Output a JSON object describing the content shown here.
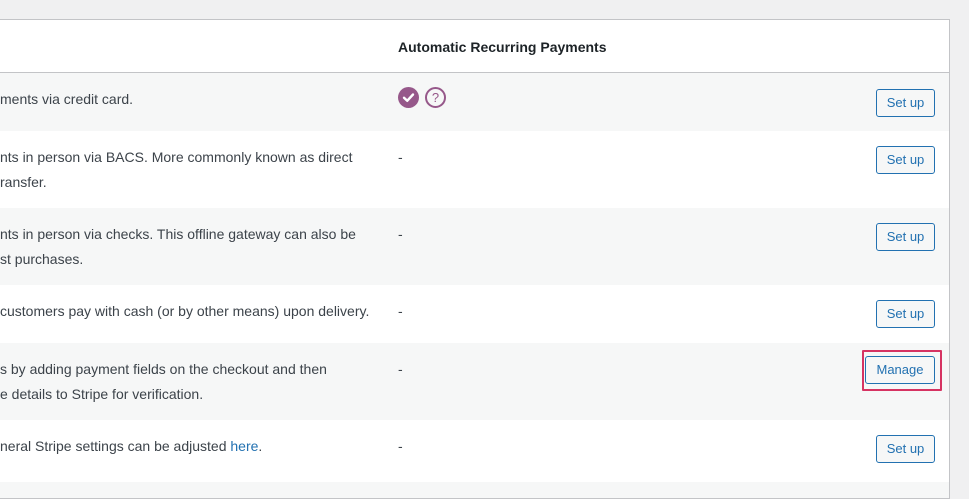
{
  "table": {
    "headers": {
      "description": "",
      "automatic_recurring_payments": "Automatic Recurring Payments"
    },
    "rows": [
      {
        "desc_lines": [
          "ments via credit card."
        ],
        "recurring": "",
        "recurring_icons": [
          "check-circle-icon",
          "help-circle-icon"
        ],
        "action": "Set up"
      },
      {
        "desc_lines": [
          "nts in person via BACS. More commonly known as direct",
          "ransfer."
        ],
        "recurring": "-",
        "action": "Set up"
      },
      {
        "desc_lines": [
          "nts in person via checks. This offline gateway can also be",
          "st purchases."
        ],
        "recurring": "-",
        "action": "Set up"
      },
      {
        "desc_lines": [
          "customers pay with cash (or by other means) upon delivery."
        ],
        "recurring": "-",
        "action": "Set up"
      },
      {
        "desc_lines": [
          "s by adding payment fields on the checkout and then",
          "e details to Stripe for verification."
        ],
        "recurring": "-",
        "action": "Manage"
      },
      {
        "desc_lines": [
          "neral Stripe settings can be adjusted "
        ],
        "desc_link": "here",
        "desc_suffix": ".",
        "recurring": "-",
        "action": "Set up"
      }
    ]
  },
  "icons": {
    "help_glyph": "?"
  },
  "colors": {
    "accent_purple": "#96588a",
    "link_blue": "#2271b1",
    "highlight": "#d63362"
  }
}
